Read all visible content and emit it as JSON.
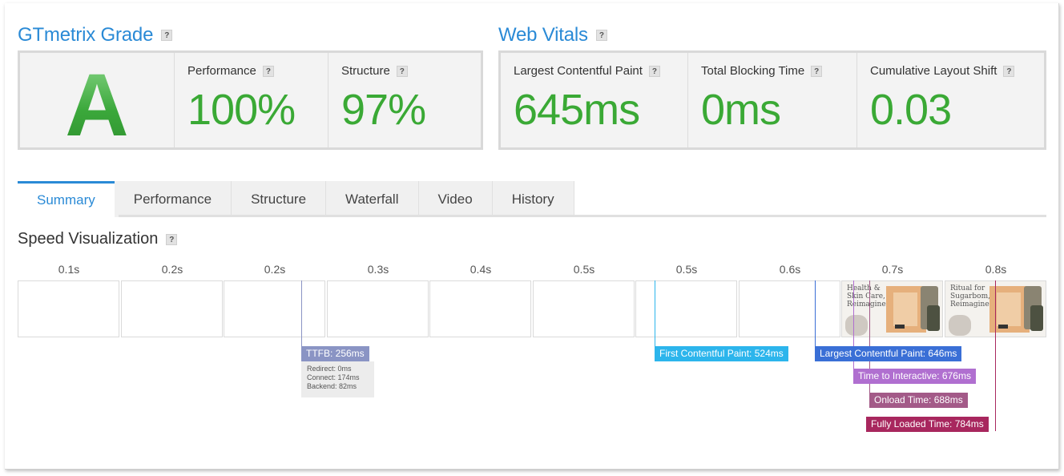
{
  "grade": {
    "title": "GTmetrix Grade",
    "letter": "A",
    "performance_label": "Performance",
    "performance_value": "100%",
    "structure_label": "Structure",
    "structure_value": "97%"
  },
  "vitals": {
    "title": "Web Vitals",
    "lcp_label": "Largest Contentful Paint",
    "lcp_value": "645ms",
    "tbt_label": "Total Blocking Time",
    "tbt_value": "0ms",
    "cls_label": "Cumulative Layout Shift",
    "cls_value": "0.03"
  },
  "help_glyph": "?",
  "tabs": [
    {
      "label": "Summary",
      "active": true
    },
    {
      "label": "Performance",
      "active": false
    },
    {
      "label": "Structure",
      "active": false
    },
    {
      "label": "Waterfall",
      "active": false
    },
    {
      "label": "Video",
      "active": false
    },
    {
      "label": "History",
      "active": false
    }
  ],
  "speed": {
    "title": "Speed Visualization",
    "ticks": [
      "0.1s",
      "0.2s",
      "0.2s",
      "0.3s",
      "0.4s",
      "0.5s",
      "0.5s",
      "0.6s",
      "0.7s",
      "0.8s"
    ],
    "thumb_text_1": "Health & Skin Care, Reimagined",
    "thumb_text_2": "Ritual for Sugarbom, Reimagined",
    "markers": {
      "ttfb": "TTFB: 256ms",
      "ttfb_redirect": "Redirect: 0ms",
      "ttfb_connect": "Connect: 174ms",
      "ttfb_backend": "Backend: 82ms",
      "fcp": "First Contentful Paint: 524ms",
      "lcp": "Largest Contentful Paint: 646ms",
      "tti": "Time to Interactive: 676ms",
      "onload": "Onload Time: 688ms",
      "fully_loaded": "Fully Loaded Time: 784ms"
    }
  },
  "colors": {
    "accent": "#2a8ad6",
    "grade_green": "#3aa935",
    "ttfb": "#8a94c4",
    "fcp": "#2cb5ec",
    "lcp": "#3a6fd6",
    "tti": "#b06fd0",
    "onload": "#a35a88",
    "fully_loaded": "#a8275e"
  }
}
